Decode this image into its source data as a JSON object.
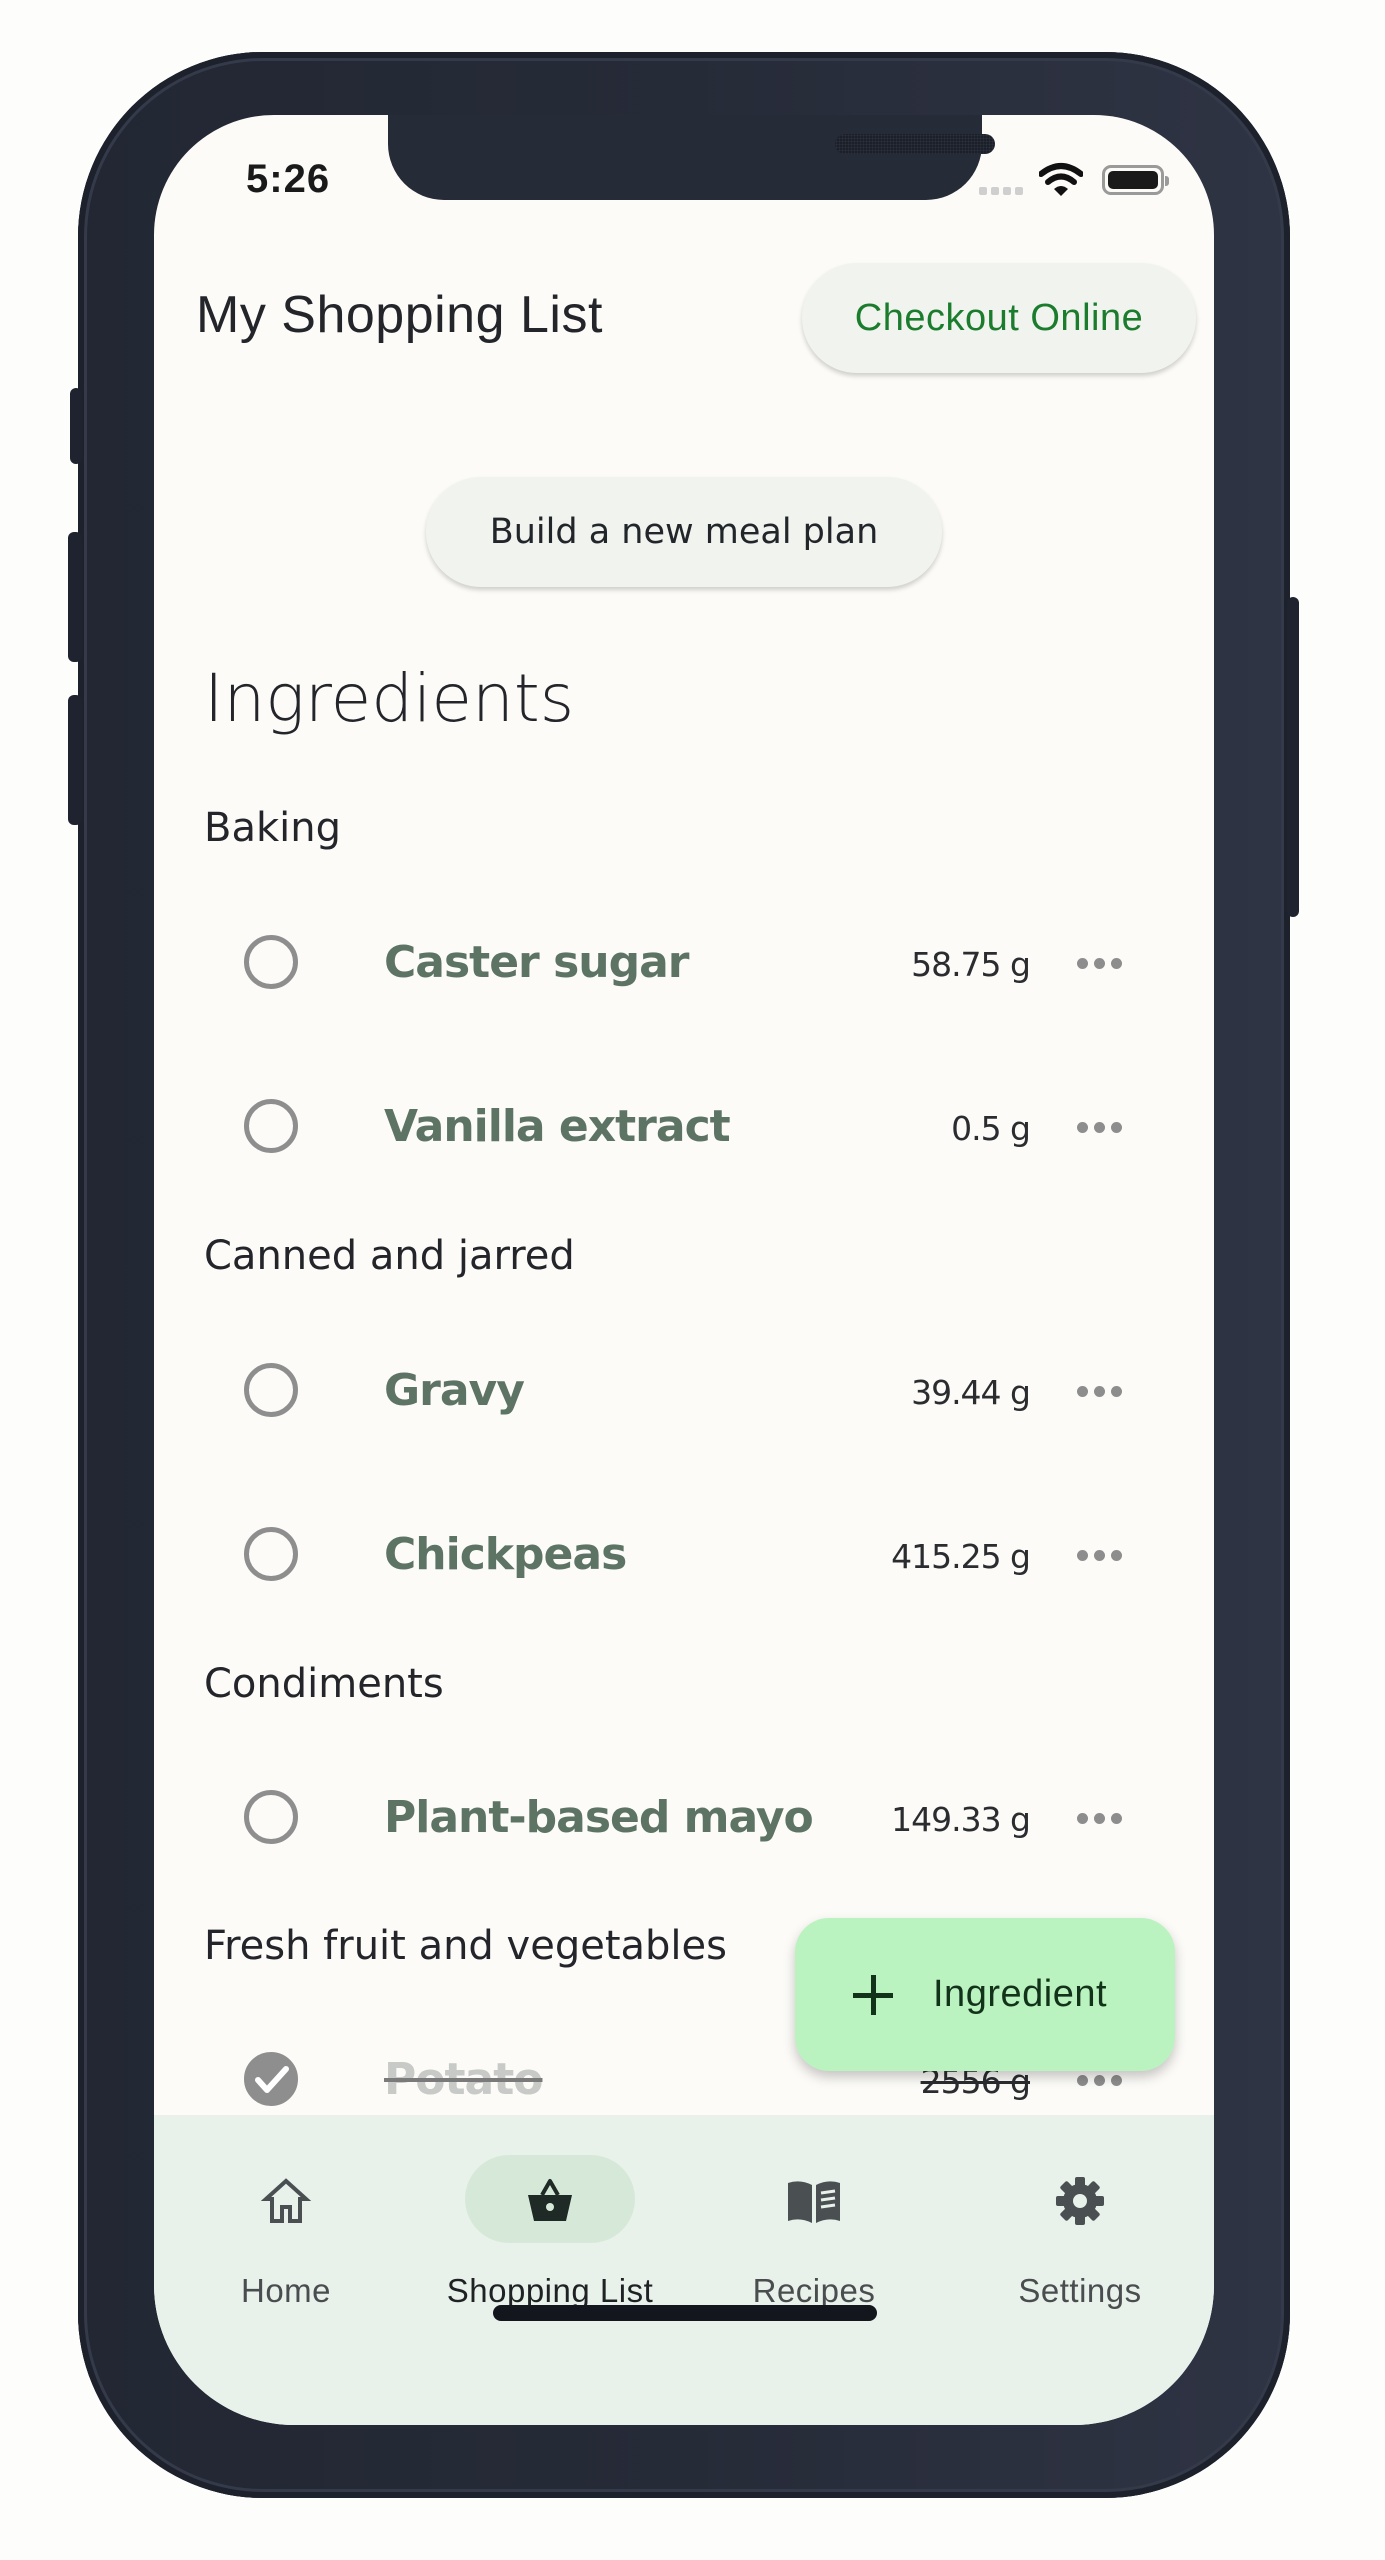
{
  "status_bar": {
    "time": "5:26",
    "icons": [
      "cellular-dots-icon",
      "wifi-icon",
      "battery-icon"
    ]
  },
  "header": {
    "title": "My Shopping List",
    "checkout_label": "Checkout Online"
  },
  "meal_plan_button": "Build a new meal plan",
  "section_title": "Ingredients",
  "categories": [
    {
      "label": "Baking",
      "items": [
        {
          "name": "Caster sugar",
          "quantity": "58.75 g",
          "checked": false
        },
        {
          "name": "Vanilla extract",
          "quantity": "0.5 g",
          "checked": false
        }
      ]
    },
    {
      "label": "Canned and jarred",
      "items": [
        {
          "name": "Gravy",
          "quantity": "39.44 g",
          "checked": false
        },
        {
          "name": "Chickpeas",
          "quantity": "415.25 g",
          "checked": false
        }
      ]
    },
    {
      "label": "Condiments",
      "items": [
        {
          "name": "Plant-based mayo",
          "quantity": "149.33 g",
          "checked": false
        }
      ]
    },
    {
      "label": "Fresh fruit and vegetables",
      "items": [
        {
          "name": "Potato",
          "quantity": "2556 g",
          "checked": true
        }
      ]
    }
  ],
  "fab": {
    "icon": "plus-icon",
    "label": "Ingredient"
  },
  "bottom_nav": {
    "active": "Shopping List",
    "items": [
      {
        "label": "Home",
        "icon": "home-icon"
      },
      {
        "label": "Shopping List",
        "icon": "shopping-basket-icon"
      },
      {
        "label": "Recipes",
        "icon": "book-icon"
      },
      {
        "label": "Settings",
        "icon": "gear-icon"
      }
    ]
  },
  "colors": {
    "accent_green_text": "#1c7c2e",
    "item_name": "#5d7364",
    "fab_background": "#bbf3c0",
    "nav_background": "#e8f1ea",
    "nav_active_pill": "#d6e9d8",
    "frame": "#262b38",
    "screen_background": "#fcfbf8"
  }
}
